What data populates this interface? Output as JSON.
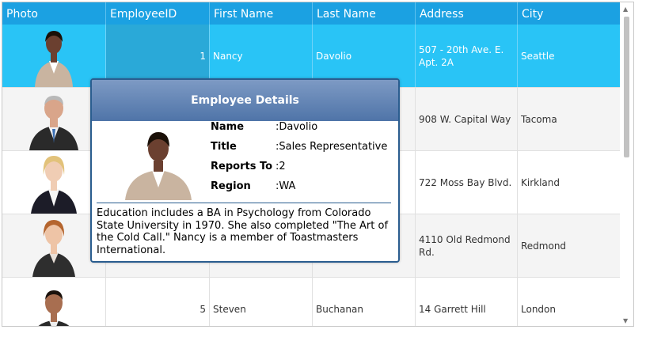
{
  "grid": {
    "columns": [
      "Photo",
      "EmployeeID",
      "First Name",
      "Last Name",
      "Address",
      "City"
    ],
    "rows": [
      {
        "id": "1",
        "first": "Nancy",
        "last": "Davolio",
        "address": "507 - 20th Ave. E. Apt. 2A",
        "city": "Seattle",
        "photo": "businesswoman-photo"
      },
      {
        "id": "",
        "first": "",
        "last": "",
        "address": "908 W. Capital Way",
        "city": "Tacoma",
        "photo": "businessman-gray-hair-photo"
      },
      {
        "id": "",
        "first": "",
        "last": "",
        "address": "722 Moss Bay Blvd.",
        "city": "Kirkland",
        "photo": "businesswoman-blonde-photo"
      },
      {
        "id": "",
        "first": "",
        "last": "",
        "address": "4110 Old Redmond Rd.",
        "city": "Redmond",
        "photo": "businesswoman-redhead-photo"
      },
      {
        "id": "5",
        "first": "Steven",
        "last": "Buchanan",
        "address": "14 Garrett Hill",
        "city": "London",
        "photo": "businessman-photo"
      }
    ]
  },
  "popup": {
    "title": "Employee Details",
    "details": [
      {
        "label": "Name",
        "value": ":Davolio"
      },
      {
        "label": "Title",
        "value": ":Sales Representative"
      },
      {
        "label": "Reports To",
        "value": ":2"
      },
      {
        "label": "Region",
        "value": ":WA"
      }
    ],
    "notes": "Education includes a BA in Psychology from Colorado State University in 1970.  She also completed \"The Art of the Cold Call.\"  Nancy is a member of Toastmasters International."
  },
  "colors": {
    "header": "#1ba1e2",
    "selected_row": "#29c4f6",
    "popup_border": "#2a5d8f"
  }
}
